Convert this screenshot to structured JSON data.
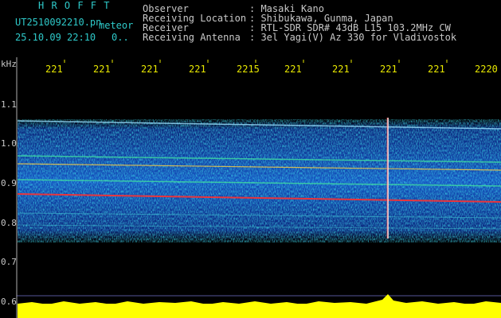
{
  "header": {
    "app_name": "H R O F F T",
    "filename": "UT2510092210.pn",
    "tag": "meteor",
    "datetime": "25.10.09 22:10",
    "extra": "0..",
    "fields": [
      {
        "label": "Observer",
        "value": ": Masaki Kano"
      },
      {
        "label": "Receiving Location",
        "value": ": Shibukawa, Gunma, Japan"
      },
      {
        "label": "Receiver",
        "value": ": RTL-SDR SDR# 43dB L15 103.2MHz CW"
      },
      {
        "label": "Receiving Antenna",
        "value": ": 3el Yagi(V) Az 330 for Vladivostok"
      }
    ]
  },
  "axis": {
    "unit": "kHz",
    "y_ticks": [
      "1.1",
      "1.0",
      "0.9",
      "0.8",
      "0.7",
      "0.6"
    ],
    "x_ticks": [
      "221",
      "221",
      "221",
      "221",
      "2215",
      "221",
      "221",
      "221",
      "221",
      "2220"
    ]
  },
  "colors": {
    "background": "#000000",
    "header_title": "#2ec9c9",
    "tick_labels": "#e8e800",
    "power_bar": "#ffff00"
  }
}
